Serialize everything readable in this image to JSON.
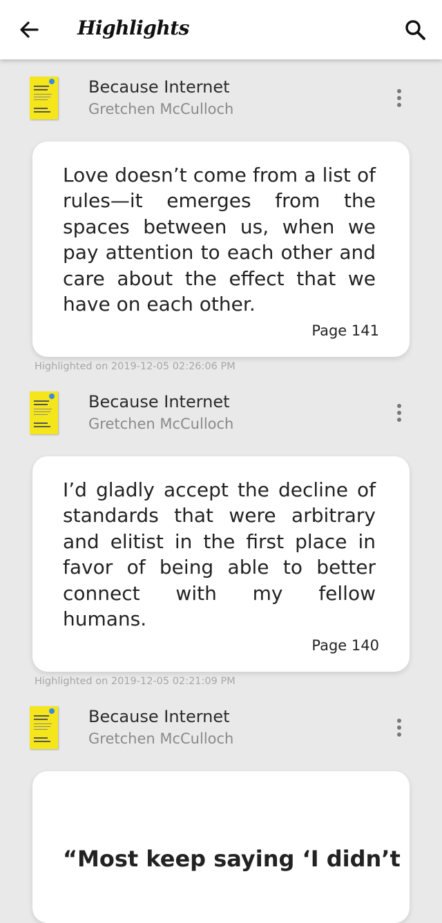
{
  "header": {
    "title": "Highlights",
    "back_icon": "arrow-left-icon",
    "search_icon": "search-icon"
  },
  "highlights": [
    {
      "book_title": "Because Internet",
      "author": "Gretchen McCulloch",
      "quote": "Love doesn’t come from a list of rules—it emerges from the spaces between us, when we pay attention to each other and care about the effect that we have on each other.",
      "page": "Page 141",
      "highlighted": "Highlighted on 2019-12-05 02:26:06 PM"
    },
    {
      "book_title": "Because Internet",
      "author": "Gretchen McCulloch",
      "quote": "I’d gladly accept the decline of standards that were arbitrary and elitist in the first place in favor of being able to better connect with my fellow humans.",
      "page": "Page 140",
      "highlighted": "Highlighted on 2019-12-05 02:21:09 PM"
    },
    {
      "book_title": "Because Internet",
      "author": "Gretchen McCulloch",
      "quote_partial": "“Most keep saying ‘I didn’t"
    }
  ],
  "colors": {
    "cover": "#f5e51b",
    "background": "#e9e9ea",
    "card": "#ffffff"
  }
}
